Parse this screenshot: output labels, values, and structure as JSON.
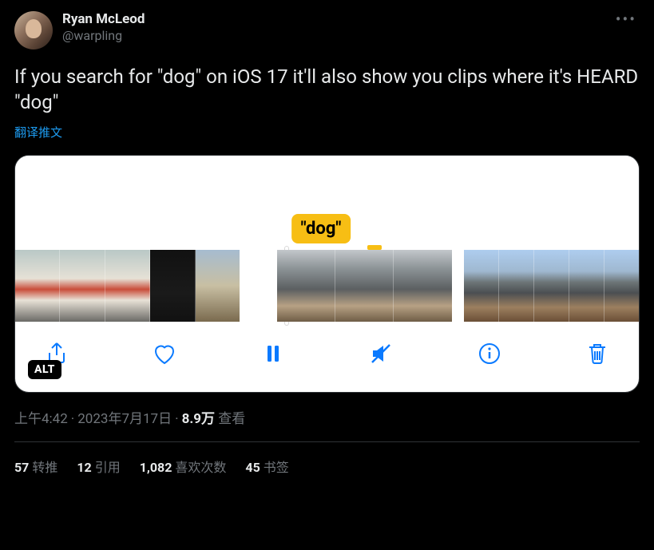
{
  "author": {
    "display_name": "Ryan McLeod",
    "handle": "@warpling"
  },
  "tweet_text": "If you search for \"dog\" on iOS 17 it'll also show you clips where it's HEARD \"dog\"",
  "translate_label": "翻译推文",
  "media": {
    "highlight_label": "\"dog\"",
    "alt_badge": "ALT"
  },
  "timestamp": {
    "time": "上午4:42",
    "date": "2023年7月17日",
    "views_number": "8.9万",
    "views_label": "查看"
  },
  "stats": {
    "retweets": {
      "count": "57",
      "label": "转推"
    },
    "quotes": {
      "count": "12",
      "label": "引用"
    },
    "likes": {
      "count": "1,082",
      "label": "喜欢次数"
    },
    "bookmarks": {
      "count": "45",
      "label": "书签"
    }
  }
}
